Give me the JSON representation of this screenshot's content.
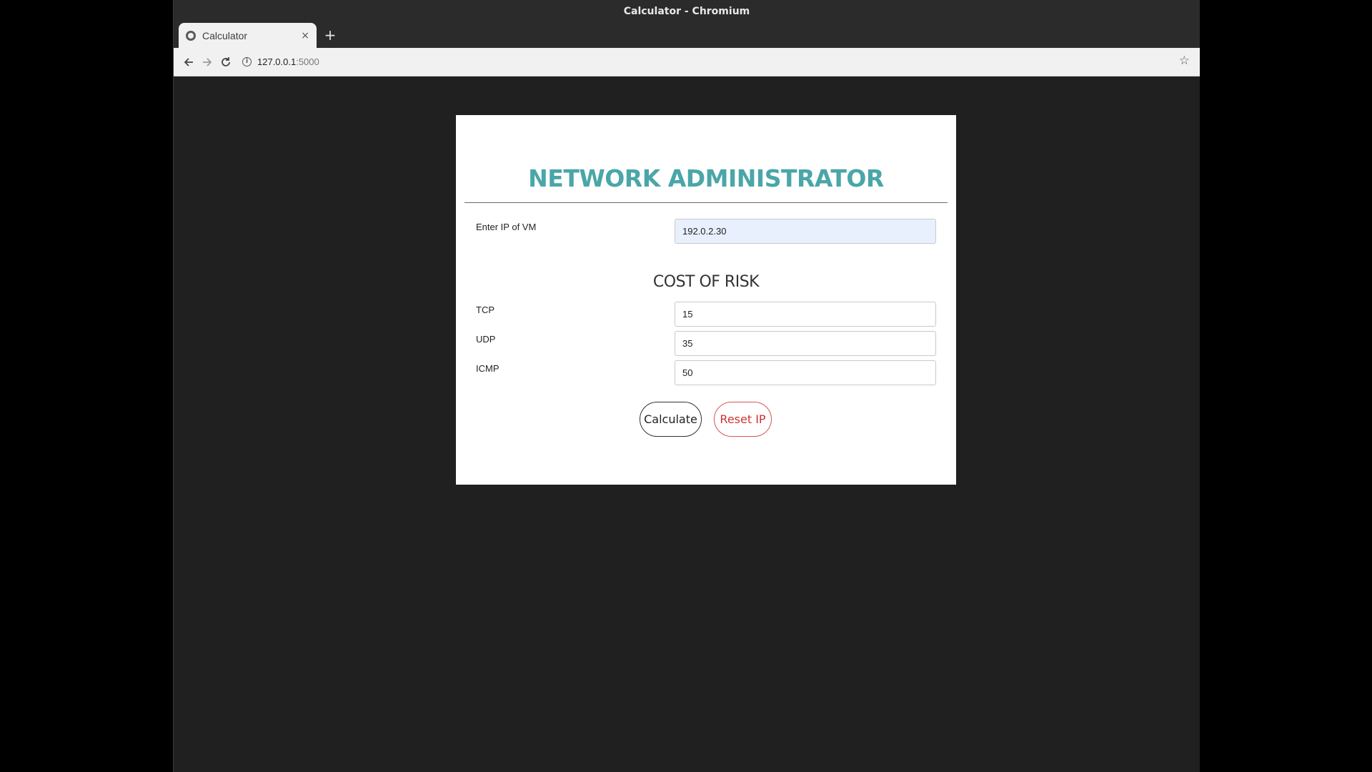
{
  "window": {
    "title": "Calculator - Chromium"
  },
  "tab": {
    "title": "Calculator",
    "close": "×"
  },
  "toolbar": {
    "url_host": "127.0.0.1",
    "url_port": ":5000",
    "new_tab": "+"
  },
  "page": {
    "heading": "NETWORK ADMINISTRATOR",
    "ip_label": "Enter IP of VM",
    "ip_value": "192.0.2.30",
    "subheading": "COST OF RISK",
    "fields": [
      {
        "label": "TCP",
        "value": "15"
      },
      {
        "label": "UDP",
        "value": "35"
      },
      {
        "label": "ICMP",
        "value": "50"
      }
    ],
    "calculate_label": "Calculate",
    "reset_label": "Reset IP"
  },
  "colors": {
    "heading": "#4aa6a8",
    "reset": "#cc3333",
    "background": "#202020"
  }
}
